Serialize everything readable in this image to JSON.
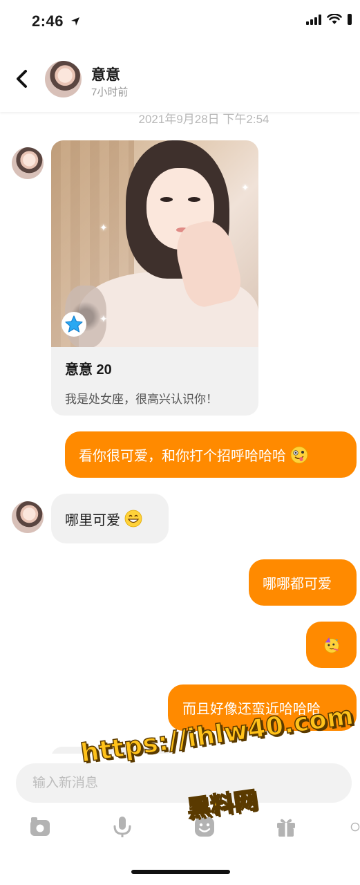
{
  "status_bar": {
    "time": "2:46",
    "icons": [
      "location-arrow-icon",
      "signal-icon",
      "wifi-icon",
      "battery-icon"
    ]
  },
  "header": {
    "contact_name": "意意",
    "last_seen": "7小时前"
  },
  "timestamp": "2021年9月28日 下午2:54",
  "profile_card": {
    "name_age": "意意 20",
    "bio": "我是处女座，很高兴认识你！",
    "badge_icon": "blue-star-icon"
  },
  "messages": [
    {
      "direction": "out",
      "text": "看你很可爱，和你打个招呼哈哈哈",
      "emoji": "zany-face-emoji"
    },
    {
      "direction": "in",
      "text": "哪里可爱",
      "emoji": "grinning-face-emoji"
    },
    {
      "direction": "out",
      "text": "哪哪都可爱"
    },
    {
      "direction": "out",
      "text": "",
      "emoji": "partying-face-emoji"
    },
    {
      "direction": "out",
      "text": "而且好像还蛮近哈哈哈"
    }
  ],
  "input": {
    "placeholder": "输入新消息"
  },
  "toolbar": [
    "image-icon",
    "microphone-icon",
    "sticker-icon",
    "gift-icon",
    "more-icon"
  ],
  "watermark": {
    "line1": "https://ihlw40.com",
    "line2": "黑料网"
  },
  "colors": {
    "accent": "#ff8a00",
    "incoming_bubble": "#f1f1f1",
    "muted_text": "#999999",
    "watermark": "#ffc21a"
  }
}
